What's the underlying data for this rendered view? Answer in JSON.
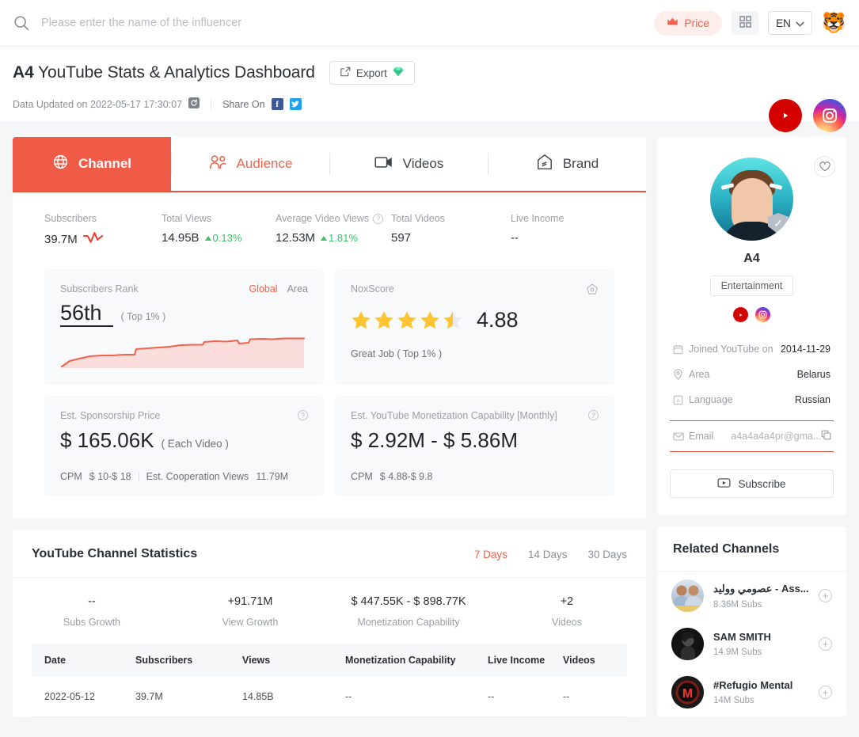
{
  "topbar": {
    "search_placeholder": "Please enter the name of the influencer",
    "search_value": "",
    "price_label": "Price",
    "lang_label": "EN",
    "avatar_emoji": "🐯",
    "icons": {
      "search": "search-icon",
      "crown": "crown-icon",
      "grid": "grid-icon",
      "chevron": "chevron-down-icon"
    }
  },
  "title": {
    "name": "A4",
    "rest": "YouTube Stats & Analytics Dashboard",
    "export_label": "Export",
    "updated_text": "Data Updated on 2022-05-17 17:30:07",
    "share_label": "Share On"
  },
  "tabs": [
    {
      "label": "Channel",
      "icon": "globe-icon",
      "state": "active"
    },
    {
      "label": "Audience",
      "icon": "people-icon",
      "state": "accent"
    },
    {
      "label": "Videos",
      "icon": "video-camera-icon",
      "state": "normal"
    },
    {
      "label": "Brand",
      "icon": "brand-tag-icon",
      "state": "normal"
    }
  ],
  "stats": [
    {
      "label": "Subscribers",
      "value": "39.7M",
      "delta": "",
      "has_spark": true
    },
    {
      "label": "Total Views",
      "value": "14.95B",
      "delta": "0.13%"
    },
    {
      "label": "Average Video Views",
      "value": "12.53M",
      "delta": "1.81%",
      "help": true
    },
    {
      "label": "Total Videos",
      "value": "597",
      "delta": ""
    },
    {
      "label": "Live Income",
      "value": "--",
      "delta": ""
    }
  ],
  "rank_card": {
    "title": "Subscribers Rank",
    "toggle_on": "Global",
    "toggle_off": "Area",
    "value": "56th",
    "note": "( Top 1% )"
  },
  "nox_card": {
    "title": "NoxScore",
    "score": "4.88",
    "note": "Great Job ( Top 1% )",
    "full_stars": 4,
    "half_stars": 1
  },
  "sponsorship_card": {
    "title": "Est. Sponsorship Price",
    "value": "$ 165.06K",
    "suffix": "( Each Video )",
    "cpm_label": "CPM",
    "cpm_value": "$ 10-$ 18",
    "coop_label": "Est. Cooperation Views",
    "coop_value": "11.79M"
  },
  "monetization_card": {
    "title": "Est. YouTube Monetization Capability [Monthly]",
    "value": "$ 2.92M - $ 5.86M",
    "cpm_label": "CPM",
    "cpm_value": "$ 4.88-$ 9.8"
  },
  "statistics": {
    "title": "YouTube Channel Statistics",
    "ranges": [
      {
        "label": "7 Days",
        "active": true
      },
      {
        "label": "14 Days",
        "active": false
      },
      {
        "label": "30 Days",
        "active": false
      }
    ],
    "growth": [
      {
        "value": "--",
        "label": "Subs Growth"
      },
      {
        "value": "+91.71M",
        "label": "View Growth"
      },
      {
        "value": "$ 447.55K - $ 898.77K",
        "label": "Monetization Capability"
      },
      {
        "value": "+2",
        "label": "Videos"
      }
    ],
    "columns": [
      "Date",
      "Subscribers",
      "Views",
      "Monetization Capability",
      "Live Income",
      "Videos"
    ],
    "rows": [
      [
        "2022-05-12",
        "39.7M",
        "14.85B",
        "--",
        "--",
        "--"
      ]
    ]
  },
  "profile": {
    "name": "A4",
    "category": "Entertainment",
    "info": [
      {
        "icon": "calendar-icon",
        "label": "Joined YouTube on",
        "value": "2014-11-29"
      },
      {
        "icon": "location-icon",
        "label": "Area",
        "value": "Belarus"
      },
      {
        "icon": "language-icon",
        "label": "Language",
        "value": "Russian"
      }
    ],
    "email_label": "Email",
    "email_value": "a4a4a4a4pr@gma...",
    "subscribe_label": "Subscribe"
  },
  "related": {
    "title": "Related Channels",
    "items": [
      {
        "name": "عصومي ووليد - Ass...",
        "subs": "8.36M Subs"
      },
      {
        "name": "SAM SMITH",
        "subs": "14.9M Subs"
      },
      {
        "name": "#Refugio Mental",
        "subs": "14M Subs"
      }
    ]
  },
  "colors": {
    "accent": "#ef5b46",
    "accent_soft": "#f0624c",
    "green": "#3cc068",
    "star": "#ffc431"
  },
  "chart_data": {
    "type": "area",
    "title": "Subscribers Rank trend",
    "x": [
      0,
      1,
      2,
      3,
      4,
      5,
      6,
      7,
      8,
      9,
      10,
      11,
      12,
      13,
      14,
      15,
      16,
      17,
      18,
      19,
      20,
      21,
      22,
      23,
      24,
      25,
      26,
      27,
      28,
      29
    ],
    "values": [
      4,
      9,
      14,
      17,
      19,
      20,
      20,
      21,
      21,
      28,
      30,
      31,
      32,
      36,
      37,
      38,
      38,
      39,
      41,
      46,
      49,
      50,
      50,
      53,
      56,
      53,
      59,
      60,
      60,
      61
    ],
    "ylabel": "",
    "xlabel": "",
    "grid": false,
    "legend": false
  }
}
